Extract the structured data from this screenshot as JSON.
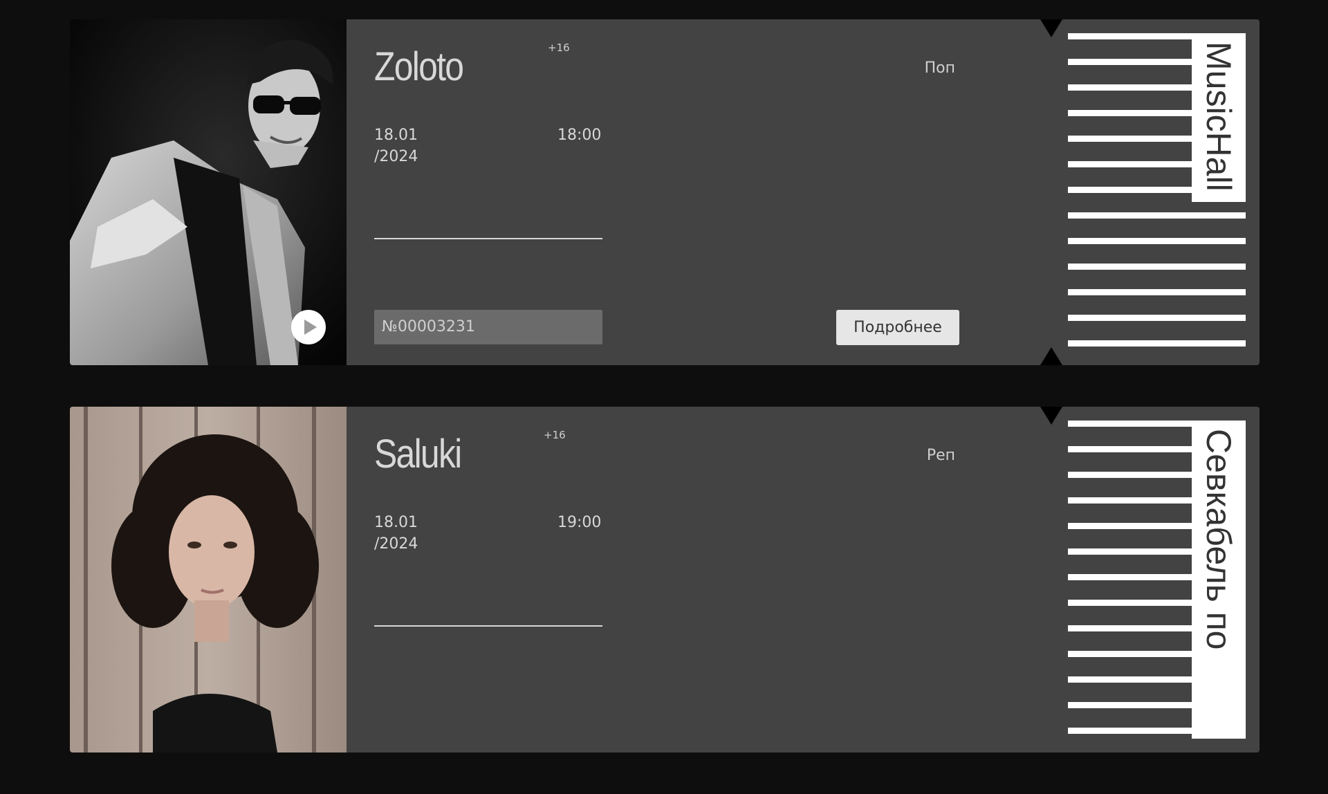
{
  "tickets": [
    {
      "artist": "Zoloto",
      "age_rating": "+16",
      "genre": "Поп",
      "date_day": "18.01",
      "date_year": "/2024",
      "time": "18:00",
      "ticket_number": "№00003231",
      "details_label": "Подробнее",
      "venue": "MusicHall",
      "photo_description": "black-and-white-concert-photo"
    },
    {
      "artist": "Saluki",
      "age_rating": "+16",
      "genre": "Реп",
      "date_day": "18.01",
      "date_year": "/2024",
      "time": "19:00",
      "venue": "Севкабель по",
      "photo_description": "portrait-photo-wooden-wall"
    }
  ],
  "icons": {
    "play": "play-icon"
  },
  "colors": {
    "page_background": "#0e0e0e",
    "ticket_background": "#434343",
    "ticket_number_background": "#6b6b6b",
    "button_background": "#e6e6e6",
    "stub_stripes": "#ffffff"
  }
}
